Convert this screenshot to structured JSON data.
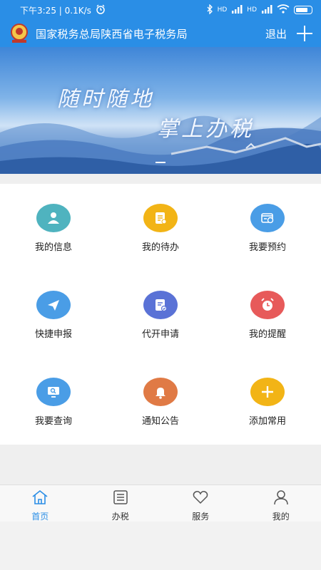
{
  "status_bar": {
    "time_speed": "下午3:25 | 0.1K/s",
    "signal1": "HD",
    "signal2": "HD"
  },
  "header": {
    "title": "国家税务总局陕西省电子税务局",
    "exit_label": "退出"
  },
  "banner": {
    "slogan_line1": "随时随地",
    "slogan_line2": "掌上办税"
  },
  "grid": {
    "items": [
      {
        "label": "我的信息",
        "icon": "person-icon",
        "color": "#4fb3bf"
      },
      {
        "label": "我的待办",
        "icon": "todo-list-icon",
        "color": "#f2b416"
      },
      {
        "label": "我要预约",
        "icon": "calendar-clock-icon",
        "color": "#4a9de6"
      },
      {
        "label": "快捷申报",
        "icon": "paper-plane-icon",
        "color": "#4a9de6"
      },
      {
        "label": "代开申请",
        "icon": "document-edit-icon",
        "color": "#5a72d6"
      },
      {
        "label": "我的提醒",
        "icon": "alarm-clock-icon",
        "color": "#e75a5a"
      },
      {
        "label": "我要查询",
        "icon": "search-screen-icon",
        "color": "#4a9de6"
      },
      {
        "label": "通知公告",
        "icon": "bell-icon",
        "color": "#e07a45"
      },
      {
        "label": "添加常用",
        "icon": "plus-icon",
        "color": "#f2b416"
      }
    ]
  },
  "bottom_nav": {
    "items": [
      {
        "label": "首页",
        "icon": "home-icon",
        "active": true
      },
      {
        "label": "办税",
        "icon": "list-icon",
        "active": false
      },
      {
        "label": "服务",
        "icon": "heart-icon",
        "active": false
      },
      {
        "label": "我的",
        "icon": "user-icon",
        "active": false
      }
    ]
  },
  "colors": {
    "primary": "#2a8ee6",
    "active_nav": "#2a8ee6"
  }
}
